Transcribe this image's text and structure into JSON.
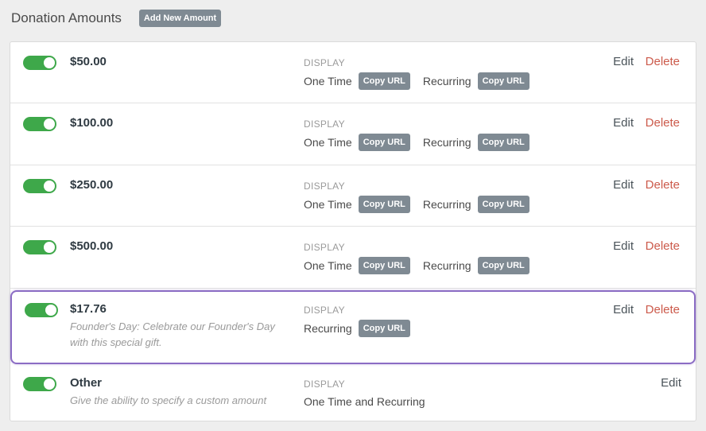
{
  "header": {
    "title": "Donation Amounts",
    "add_button": "Add New Amount"
  },
  "labels": {
    "display": "DISPLAY",
    "one_time": "One Time",
    "recurring": "Recurring",
    "copy_url": "Copy URL",
    "edit": "Edit",
    "delete": "Delete",
    "one_time_and_recurring": "One Time and Recurring"
  },
  "rows": [
    {
      "amount": "$50.00",
      "enabled": true
    },
    {
      "amount": "$100.00",
      "enabled": true
    },
    {
      "amount": "$250.00",
      "enabled": true
    },
    {
      "amount": "$500.00",
      "enabled": true
    },
    {
      "amount": "$17.76",
      "enabled": true,
      "description": "Founder's Day: Celebrate our Founder's Day with this special gift."
    },
    {
      "amount": "Other",
      "enabled": true,
      "description": "Give the ability to specify a custom amount"
    }
  ],
  "colors": {
    "toggle_on": "#3ea84a",
    "button": "#7f8a93",
    "delete": "#cc5a4b",
    "highlight": "#8b6cc4"
  }
}
